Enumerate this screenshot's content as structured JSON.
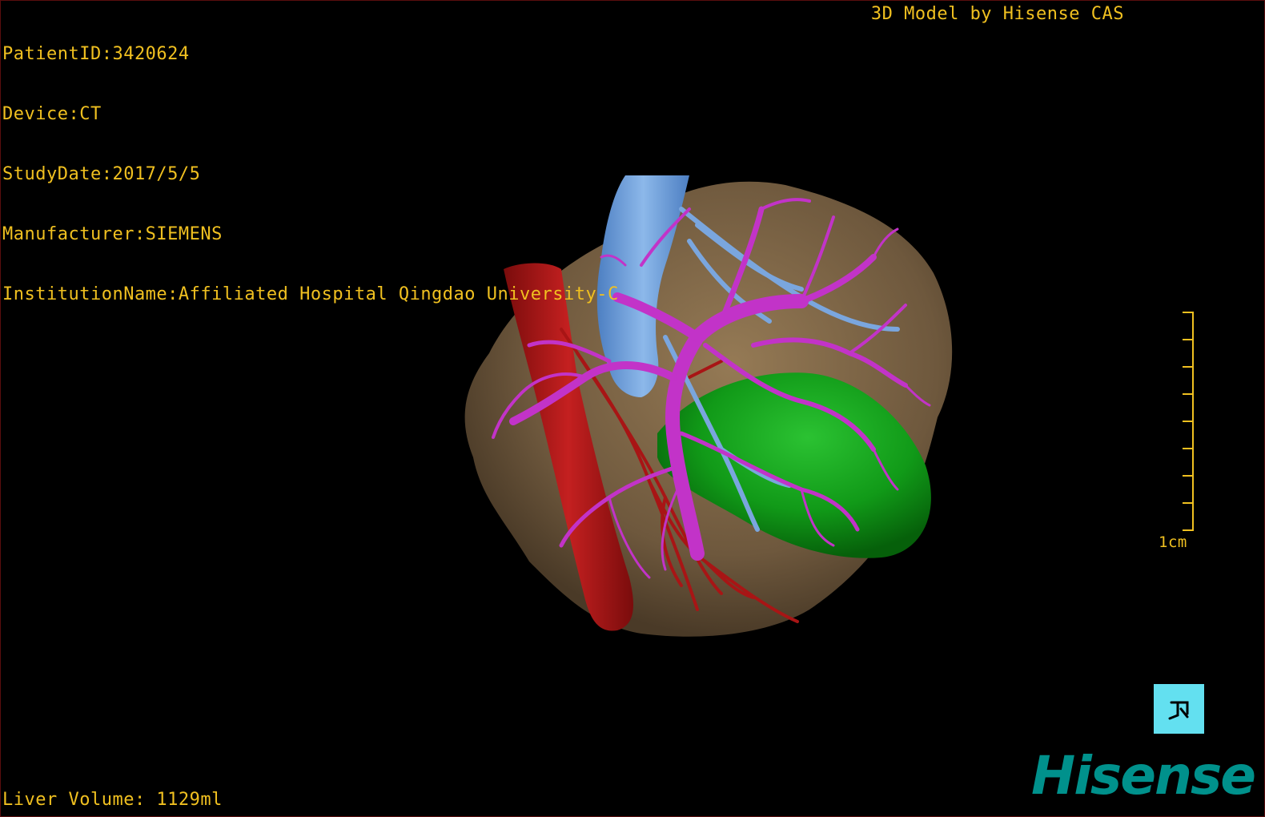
{
  "patient_info": {
    "lines": [
      "PatientID:3420624",
      "Device:CT",
      "StudyDate:2017/5/5",
      "Manufacturer:SIEMENS",
      "InstitutionName:Affiliated Hospital Qingdao University-C"
    ]
  },
  "credit": "3D Model by Hisense CAS",
  "liver_volume": "Liver Volume: 1129ml",
  "scale": {
    "label": "1cm",
    "ticks": 8
  },
  "orientation_button": {
    "icon": "body-orientation-icon"
  },
  "logo": "Hisense",
  "colors": {
    "overlay_text": "#f0c020",
    "liver": "#7d6648",
    "portal_vein": "#c233c8",
    "hepatic_vein": "#6f9fd8",
    "artery": "#b01818",
    "gallbladder_tumor": "#129a1a",
    "logo": "#00918c",
    "orientation_button": "#63e0f0"
  }
}
